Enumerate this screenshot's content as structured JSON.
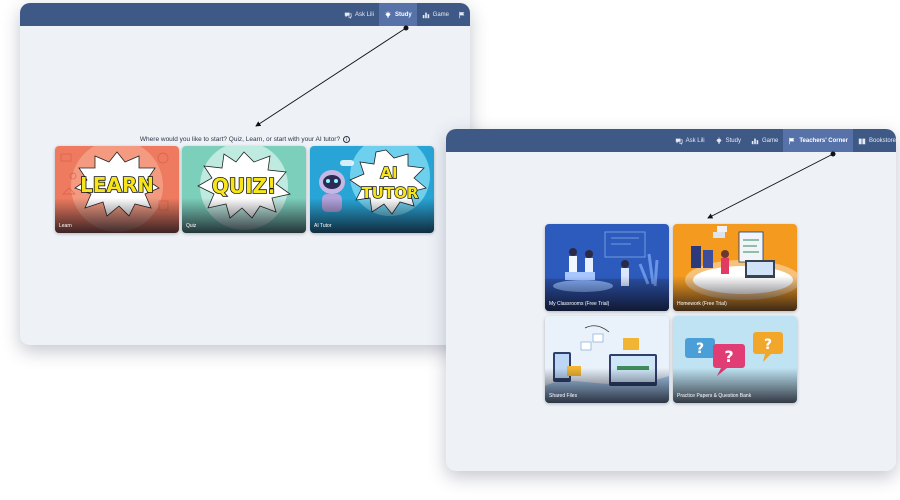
{
  "window1": {
    "nav": [
      {
        "label": "Ask Lili",
        "icon": "chat-icon",
        "active": false
      },
      {
        "label": "Study",
        "icon": "lightbulb-icon",
        "active": true
      },
      {
        "label": "Game",
        "icon": "chart-icon",
        "active": false
      }
    ],
    "prompt": "Where would you like to start? Quiz, Learn, or start with your AI tutor?",
    "info_glyph": "i",
    "cards": [
      {
        "label": "Learn",
        "title": "LEARN"
      },
      {
        "label": "Quiz",
        "title": "QUIZ!"
      },
      {
        "label": "AI Tutor",
        "title_line1": "AI",
        "title_line2": "TUTOR"
      }
    ]
  },
  "window2": {
    "nav": [
      {
        "label": "Ask Lili",
        "icon": "chat-icon",
        "active": false
      },
      {
        "label": "Study",
        "icon": "lightbulb-icon",
        "active": false
      },
      {
        "label": "Game",
        "icon": "chart-icon",
        "active": false
      },
      {
        "label": "Teachers' Corner",
        "icon": "flag-icon",
        "active": true
      },
      {
        "label": "Bookstore",
        "icon": "book-icon",
        "active": false
      }
    ],
    "cards": [
      {
        "label": "My Classrooms (Free Trial)"
      },
      {
        "label": "Homework (Free Trial)"
      },
      {
        "label": "Shared Files"
      },
      {
        "label": "Practice Papers & Question Bank"
      }
    ]
  },
  "colors": {
    "topbar": "#3f5986",
    "nav_active": "#5672a8",
    "window_bg": "#eef2f7",
    "learn": "#ef7d62",
    "quiz": "#7fd3bf",
    "ai_tutor": "#2aa6d6",
    "comic_yellow": "#f6e51a"
  }
}
